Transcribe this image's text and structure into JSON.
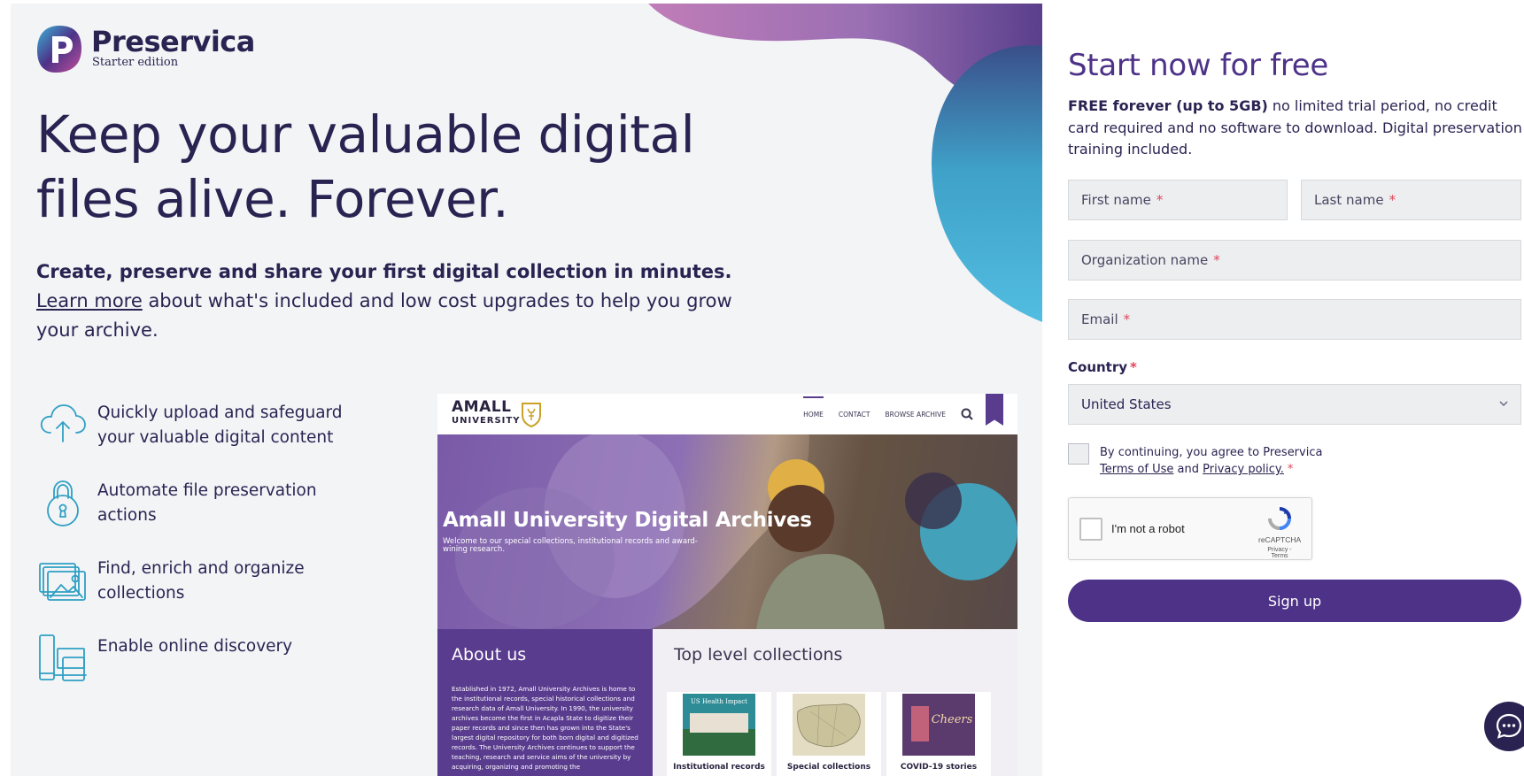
{
  "brand": {
    "name": "Preservica",
    "edition": "Starter edition"
  },
  "hero": {
    "title": "Keep your valuable digital files alive. Forever.",
    "desc_bold": "Create, preserve and share your first digital collection in minutes.",
    "learn_more": "Learn more",
    "desc_rest": " about what's included and low cost upgrades to help you grow your archive."
  },
  "features": [
    {
      "icon": "cloud-upload-icon",
      "text": "Quickly upload and safeguard your valuable digital content"
    },
    {
      "icon": "lock-icon",
      "text": "Automate file preservation actions"
    },
    {
      "icon": "image-stack-icon",
      "text": "Find, enrich and organize collections"
    },
    {
      "icon": "devices-icon",
      "text": "Enable online discovery"
    }
  ],
  "preview": {
    "logo_top": "AMALL",
    "logo_bottom": "UNIVERSITY",
    "nav": [
      "HOME",
      "CONTACT",
      "BROWSE ARCHIVE"
    ],
    "hero_title": "Amall University Digital Archives",
    "hero_sub": "Welcome to our special collections, institutional records and award-wining research.",
    "about_title": "About us",
    "about_text": "Established in 1972, Amall University Archives is home to the institutional records, special historical collections and research data of Amall University. In 1990, the university archives become the first in Acapla State to digitize their paper records and since then has grown into the State's largest digital repository for both born digital and digitized records. The University Archives continues to support the teaching, research and service aims of the university by acquiring, organizing and promoting the",
    "top_title": "Top level collections",
    "cards": [
      {
        "label": "Institutional records",
        "thumb_text": "US Health Impact"
      },
      {
        "label": "Special collections",
        "thumb_text": ""
      },
      {
        "label": "COVID-19 stories",
        "thumb_text": "Cheers"
      }
    ]
  },
  "form": {
    "title": "Start now for free",
    "intro_bold": "FREE forever (up to 5GB)",
    "intro_rest": " no limited trial period, no credit card required and no software to download. Digital preservation training included.",
    "first_name": "First name",
    "last_name": "Last name",
    "organization": "Organization name",
    "email": "Email",
    "country_label": "Country",
    "country_value": "United States",
    "agree_prefix": "By continuing, you agree to Preservica",
    "terms": "Terms of Use",
    "and": "and",
    "privacy": "Privacy policy.",
    "required_mark": "*",
    "captcha_label": "I'm not a robot",
    "captcha_brand": "reCAPTCHA",
    "captcha_links": "Privacy - Terms",
    "submit": "Sign up"
  },
  "colors": {
    "brand_purple": "#4d3288",
    "navy": "#2a2352",
    "teal": "#4fb3d2",
    "required": "#e0455a"
  }
}
